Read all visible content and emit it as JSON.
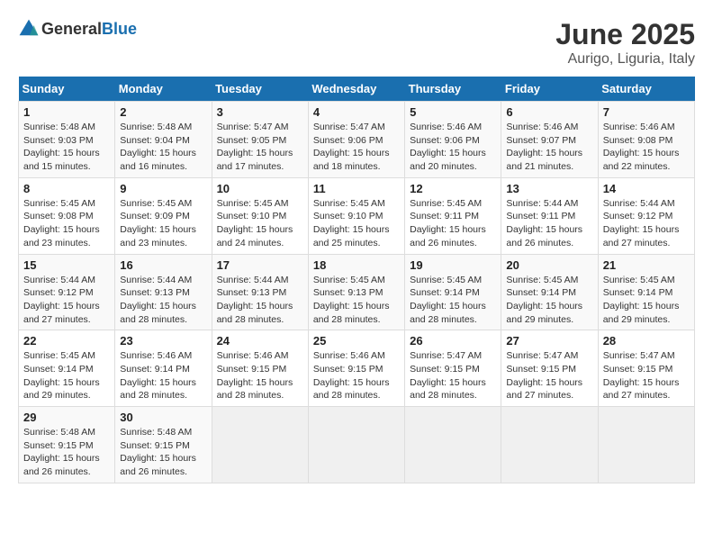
{
  "header": {
    "logo_general": "General",
    "logo_blue": "Blue",
    "title": "June 2025",
    "subtitle": "Aurigo, Liguria, Italy"
  },
  "calendar": {
    "days_of_week": [
      "Sunday",
      "Monday",
      "Tuesday",
      "Wednesday",
      "Thursday",
      "Friday",
      "Saturday"
    ],
    "weeks": [
      [
        {
          "day": "",
          "sunrise": "",
          "sunset": "",
          "daylight": ""
        },
        {
          "day": "2",
          "sunrise": "Sunrise: 5:48 AM",
          "sunset": "Sunset: 9:04 PM",
          "daylight": "Daylight: 15 hours and 16 minutes."
        },
        {
          "day": "3",
          "sunrise": "Sunrise: 5:47 AM",
          "sunset": "Sunset: 9:05 PM",
          "daylight": "Daylight: 15 hours and 17 minutes."
        },
        {
          "day": "4",
          "sunrise": "Sunrise: 5:47 AM",
          "sunset": "Sunset: 9:06 PM",
          "daylight": "Daylight: 15 hours and 18 minutes."
        },
        {
          "day": "5",
          "sunrise": "Sunrise: 5:46 AM",
          "sunset": "Sunset: 9:06 PM",
          "daylight": "Daylight: 15 hours and 20 minutes."
        },
        {
          "day": "6",
          "sunrise": "Sunrise: 5:46 AM",
          "sunset": "Sunset: 9:07 PM",
          "daylight": "Daylight: 15 hours and 21 minutes."
        },
        {
          "day": "7",
          "sunrise": "Sunrise: 5:46 AM",
          "sunset": "Sunset: 9:08 PM",
          "daylight": "Daylight: 15 hours and 22 minutes."
        }
      ],
      [
        {
          "day": "8",
          "sunrise": "Sunrise: 5:45 AM",
          "sunset": "Sunset: 9:08 PM",
          "daylight": "Daylight: 15 hours and 23 minutes."
        },
        {
          "day": "9",
          "sunrise": "Sunrise: 5:45 AM",
          "sunset": "Sunset: 9:09 PM",
          "daylight": "Daylight: 15 hours and 23 minutes."
        },
        {
          "day": "10",
          "sunrise": "Sunrise: 5:45 AM",
          "sunset": "Sunset: 9:10 PM",
          "daylight": "Daylight: 15 hours and 24 minutes."
        },
        {
          "day": "11",
          "sunrise": "Sunrise: 5:45 AM",
          "sunset": "Sunset: 9:10 PM",
          "daylight": "Daylight: 15 hours and 25 minutes."
        },
        {
          "day": "12",
          "sunrise": "Sunrise: 5:45 AM",
          "sunset": "Sunset: 9:11 PM",
          "daylight": "Daylight: 15 hours and 26 minutes."
        },
        {
          "day": "13",
          "sunrise": "Sunrise: 5:44 AM",
          "sunset": "Sunset: 9:11 PM",
          "daylight": "Daylight: 15 hours and 26 minutes."
        },
        {
          "day": "14",
          "sunrise": "Sunrise: 5:44 AM",
          "sunset": "Sunset: 9:12 PM",
          "daylight": "Daylight: 15 hours and 27 minutes."
        }
      ],
      [
        {
          "day": "15",
          "sunrise": "Sunrise: 5:44 AM",
          "sunset": "Sunset: 9:12 PM",
          "daylight": "Daylight: 15 hours and 27 minutes."
        },
        {
          "day": "16",
          "sunrise": "Sunrise: 5:44 AM",
          "sunset": "Sunset: 9:13 PM",
          "daylight": "Daylight: 15 hours and 28 minutes."
        },
        {
          "day": "17",
          "sunrise": "Sunrise: 5:44 AM",
          "sunset": "Sunset: 9:13 PM",
          "daylight": "Daylight: 15 hours and 28 minutes."
        },
        {
          "day": "18",
          "sunrise": "Sunrise: 5:45 AM",
          "sunset": "Sunset: 9:13 PM",
          "daylight": "Daylight: 15 hours and 28 minutes."
        },
        {
          "day": "19",
          "sunrise": "Sunrise: 5:45 AM",
          "sunset": "Sunset: 9:14 PM",
          "daylight": "Daylight: 15 hours and 28 minutes."
        },
        {
          "day": "20",
          "sunrise": "Sunrise: 5:45 AM",
          "sunset": "Sunset: 9:14 PM",
          "daylight": "Daylight: 15 hours and 29 minutes."
        },
        {
          "day": "21",
          "sunrise": "Sunrise: 5:45 AM",
          "sunset": "Sunset: 9:14 PM",
          "daylight": "Daylight: 15 hours and 29 minutes."
        }
      ],
      [
        {
          "day": "22",
          "sunrise": "Sunrise: 5:45 AM",
          "sunset": "Sunset: 9:14 PM",
          "daylight": "Daylight: 15 hours and 29 minutes."
        },
        {
          "day": "23",
          "sunrise": "Sunrise: 5:46 AM",
          "sunset": "Sunset: 9:14 PM",
          "daylight": "Daylight: 15 hours and 28 minutes."
        },
        {
          "day": "24",
          "sunrise": "Sunrise: 5:46 AM",
          "sunset": "Sunset: 9:15 PM",
          "daylight": "Daylight: 15 hours and 28 minutes."
        },
        {
          "day": "25",
          "sunrise": "Sunrise: 5:46 AM",
          "sunset": "Sunset: 9:15 PM",
          "daylight": "Daylight: 15 hours and 28 minutes."
        },
        {
          "day": "26",
          "sunrise": "Sunrise: 5:47 AM",
          "sunset": "Sunset: 9:15 PM",
          "daylight": "Daylight: 15 hours and 28 minutes."
        },
        {
          "day": "27",
          "sunrise": "Sunrise: 5:47 AM",
          "sunset": "Sunset: 9:15 PM",
          "daylight": "Daylight: 15 hours and 27 minutes."
        },
        {
          "day": "28",
          "sunrise": "Sunrise: 5:47 AM",
          "sunset": "Sunset: 9:15 PM",
          "daylight": "Daylight: 15 hours and 27 minutes."
        }
      ],
      [
        {
          "day": "29",
          "sunrise": "Sunrise: 5:48 AM",
          "sunset": "Sunset: 9:15 PM",
          "daylight": "Daylight: 15 hours and 26 minutes."
        },
        {
          "day": "30",
          "sunrise": "Sunrise: 5:48 AM",
          "sunset": "Sunset: 9:15 PM",
          "daylight": "Daylight: 15 hours and 26 minutes."
        },
        {
          "day": "",
          "sunrise": "",
          "sunset": "",
          "daylight": ""
        },
        {
          "day": "",
          "sunrise": "",
          "sunset": "",
          "daylight": ""
        },
        {
          "day": "",
          "sunrise": "",
          "sunset": "",
          "daylight": ""
        },
        {
          "day": "",
          "sunrise": "",
          "sunset": "",
          "daylight": ""
        },
        {
          "day": "",
          "sunrise": "",
          "sunset": "",
          "daylight": ""
        }
      ]
    ],
    "week1_day1": {
      "day": "1",
      "sunrise": "Sunrise: 5:48 AM",
      "sunset": "Sunset: 9:03 PM",
      "daylight": "Daylight: 15 hours and 15 minutes."
    }
  }
}
